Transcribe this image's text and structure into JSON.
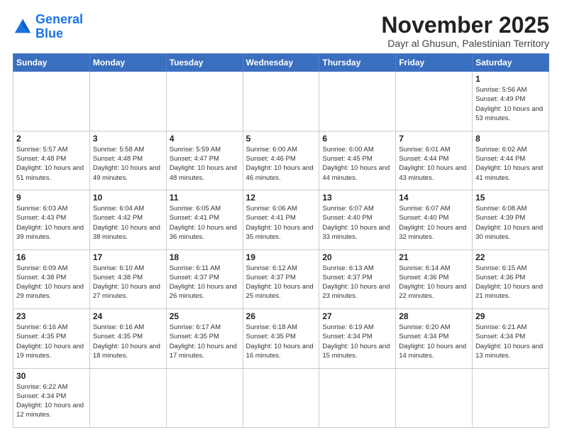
{
  "logo": {
    "line1": "General",
    "line2": "Blue"
  },
  "header": {
    "month": "November 2025",
    "location": "Dayr al Ghusun, Palestinian Territory"
  },
  "weekdays": [
    "Sunday",
    "Monday",
    "Tuesday",
    "Wednesday",
    "Thursday",
    "Friday",
    "Saturday"
  ],
  "days": {
    "1": {
      "sunrise": "5:56 AM",
      "sunset": "4:49 PM",
      "daylight": "10 hours and 53 minutes."
    },
    "2": {
      "sunrise": "5:57 AM",
      "sunset": "4:48 PM",
      "daylight": "10 hours and 51 minutes."
    },
    "3": {
      "sunrise": "5:58 AM",
      "sunset": "4:48 PM",
      "daylight": "10 hours and 49 minutes."
    },
    "4": {
      "sunrise": "5:59 AM",
      "sunset": "4:47 PM",
      "daylight": "10 hours and 48 minutes."
    },
    "5": {
      "sunrise": "6:00 AM",
      "sunset": "4:46 PM",
      "daylight": "10 hours and 46 minutes."
    },
    "6": {
      "sunrise": "6:00 AM",
      "sunset": "4:45 PM",
      "daylight": "10 hours and 44 minutes."
    },
    "7": {
      "sunrise": "6:01 AM",
      "sunset": "4:44 PM",
      "daylight": "10 hours and 43 minutes."
    },
    "8": {
      "sunrise": "6:02 AM",
      "sunset": "4:44 PM",
      "daylight": "10 hours and 41 minutes."
    },
    "9": {
      "sunrise": "6:03 AM",
      "sunset": "4:43 PM",
      "daylight": "10 hours and 39 minutes."
    },
    "10": {
      "sunrise": "6:04 AM",
      "sunset": "4:42 PM",
      "daylight": "10 hours and 38 minutes."
    },
    "11": {
      "sunrise": "6:05 AM",
      "sunset": "4:41 PM",
      "daylight": "10 hours and 36 minutes."
    },
    "12": {
      "sunrise": "6:06 AM",
      "sunset": "4:41 PM",
      "daylight": "10 hours and 35 minutes."
    },
    "13": {
      "sunrise": "6:07 AM",
      "sunset": "4:40 PM",
      "daylight": "10 hours and 33 minutes."
    },
    "14": {
      "sunrise": "6:07 AM",
      "sunset": "4:40 PM",
      "daylight": "10 hours and 32 minutes."
    },
    "15": {
      "sunrise": "6:08 AM",
      "sunset": "4:39 PM",
      "daylight": "10 hours and 30 minutes."
    },
    "16": {
      "sunrise": "6:09 AM",
      "sunset": "4:38 PM",
      "daylight": "10 hours and 29 minutes."
    },
    "17": {
      "sunrise": "6:10 AM",
      "sunset": "4:38 PM",
      "daylight": "10 hours and 27 minutes."
    },
    "18": {
      "sunrise": "6:11 AM",
      "sunset": "4:37 PM",
      "daylight": "10 hours and 26 minutes."
    },
    "19": {
      "sunrise": "6:12 AM",
      "sunset": "4:37 PM",
      "daylight": "10 hours and 25 minutes."
    },
    "20": {
      "sunrise": "6:13 AM",
      "sunset": "4:37 PM",
      "daylight": "10 hours and 23 minutes."
    },
    "21": {
      "sunrise": "6:14 AM",
      "sunset": "4:36 PM",
      "daylight": "10 hours and 22 minutes."
    },
    "22": {
      "sunrise": "6:15 AM",
      "sunset": "4:36 PM",
      "daylight": "10 hours and 21 minutes."
    },
    "23": {
      "sunrise": "6:16 AM",
      "sunset": "4:35 PM",
      "daylight": "10 hours and 19 minutes."
    },
    "24": {
      "sunrise": "6:16 AM",
      "sunset": "4:35 PM",
      "daylight": "10 hours and 18 minutes."
    },
    "25": {
      "sunrise": "6:17 AM",
      "sunset": "4:35 PM",
      "daylight": "10 hours and 17 minutes."
    },
    "26": {
      "sunrise": "6:18 AM",
      "sunset": "4:35 PM",
      "daylight": "10 hours and 16 minutes."
    },
    "27": {
      "sunrise": "6:19 AM",
      "sunset": "4:34 PM",
      "daylight": "10 hours and 15 minutes."
    },
    "28": {
      "sunrise": "6:20 AM",
      "sunset": "4:34 PM",
      "daylight": "10 hours and 14 minutes."
    },
    "29": {
      "sunrise": "6:21 AM",
      "sunset": "4:34 PM",
      "daylight": "10 hours and 13 minutes."
    },
    "30": {
      "sunrise": "6:22 AM",
      "sunset": "4:34 PM",
      "daylight": "10 hours and 12 minutes."
    }
  }
}
